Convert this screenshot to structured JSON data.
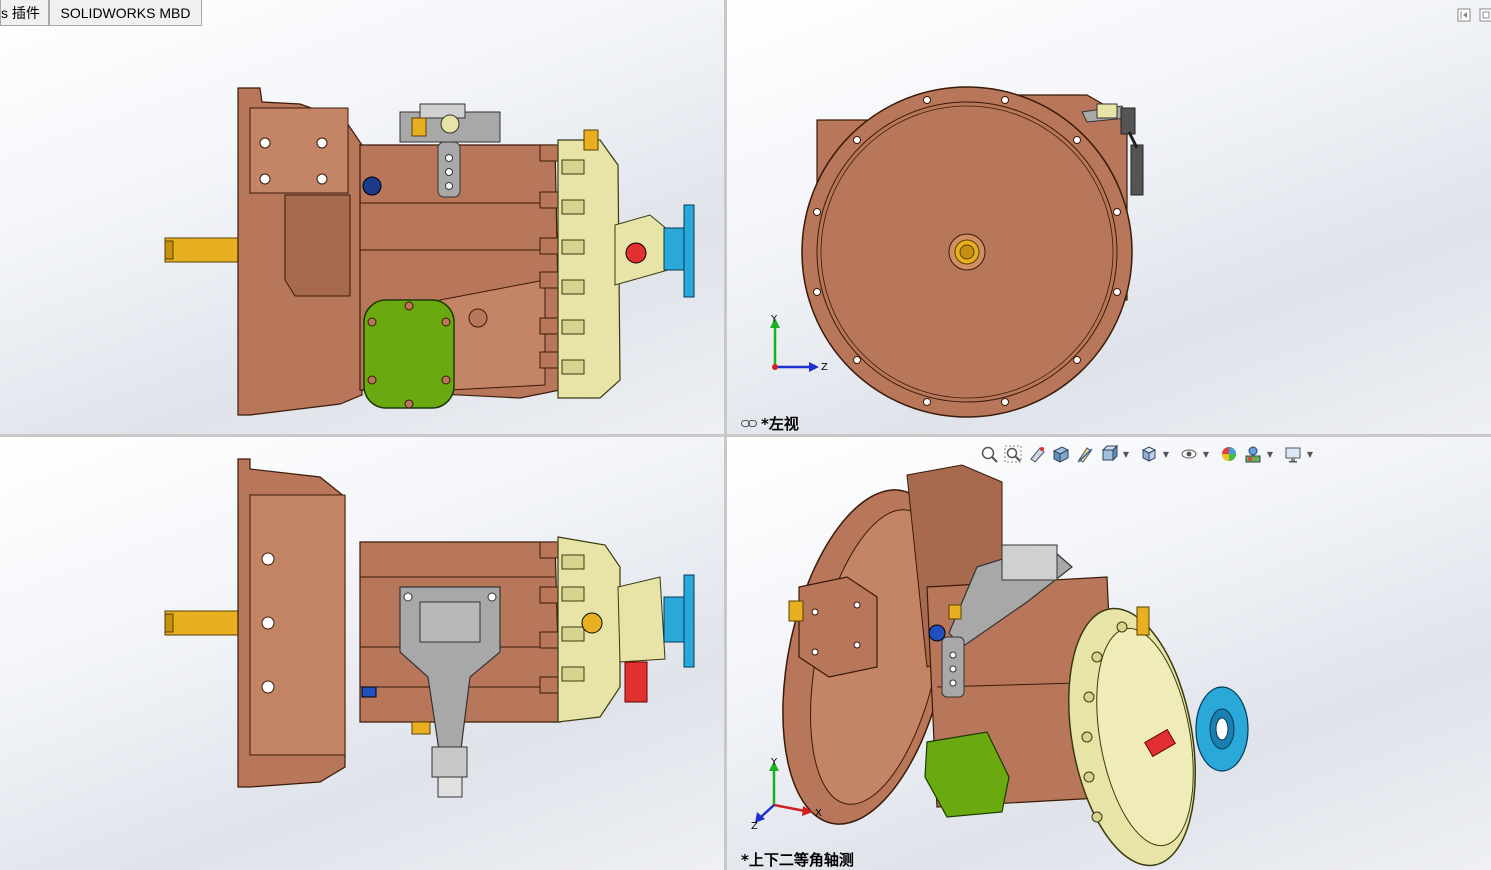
{
  "tabs": {
    "plugins_partial": "s 插件",
    "mbd": "SOLIDWORKS MBD"
  },
  "viewports": {
    "top_right_label": "*左视",
    "bottom_right_label": "*上下二等角轴测"
  },
  "triads": {
    "left_view": {
      "up": "Y",
      "right": "Z"
    },
    "iso_view": {
      "up": "Y",
      "right": "X",
      "down": "Z"
    }
  },
  "hud_toolbar": {
    "icons": [
      "zoom-to-fit-icon",
      "zoom-to-area-icon",
      "previous-view-icon",
      "section-view-icon",
      "dynamic-annotation-icon",
      "view-orientation-icon",
      "display-style-icon",
      "hide-show-icon",
      "edit-appearance-icon",
      "apply-scene-icon",
      "view-settings-icon"
    ]
  },
  "colors": {
    "housing": "#b8765a",
    "housing_dark": "#8a4a30",
    "pump": "#e8e4a8",
    "flange": "#2aa8d8",
    "cover": "#6aaa10",
    "shaft": "#e8b020",
    "bracket": "#a8a8a8",
    "fitting_red": "#e03030",
    "background_top": "#ffffff",
    "background_bottom": "#dfe3ea"
  }
}
